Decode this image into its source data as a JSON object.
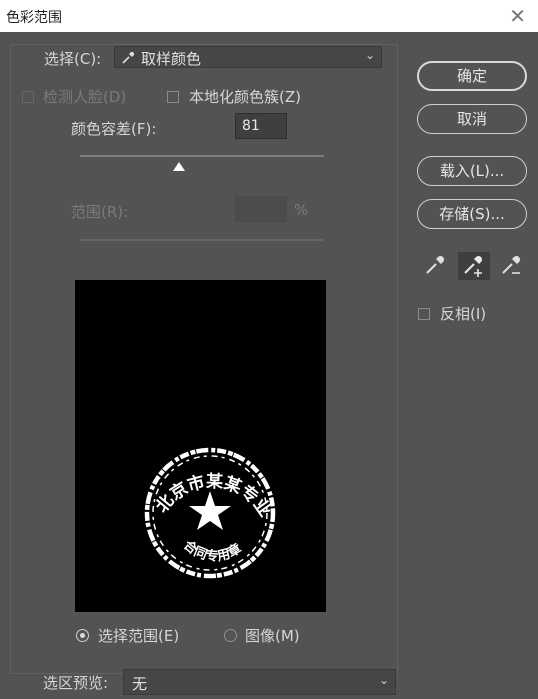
{
  "window": {
    "title": "色彩范围",
    "close_glyph": "✕"
  },
  "select": {
    "label": "选择(C):",
    "value": "取样颜色",
    "icon": "eyedropper-icon"
  },
  "detect_faces": {
    "label": "检测人脸(D)",
    "checked": false,
    "enabled": false
  },
  "localized": {
    "label": "本地化颜色簇(Z)",
    "checked": false
  },
  "fuzziness": {
    "label": "颜色容差(F):",
    "value": "81",
    "slider_fraction": 0.405
  },
  "range": {
    "label": "范围(R):",
    "value": "",
    "unit": "%",
    "enabled": false
  },
  "view_options": {
    "selection_label": "选择范围(E)",
    "image_label": "图像(M)",
    "selected": "selection"
  },
  "selection_preview": {
    "label": "选区预览:",
    "value": "无"
  },
  "buttons": {
    "ok": "确定",
    "cancel": "取消",
    "load": "载入(L)...",
    "save": "存储(S)..."
  },
  "droppers": {
    "sample": "eyedropper-icon",
    "add": "eyedropper-plus-icon",
    "subtract": "eyedropper-minus-icon",
    "active": "add"
  },
  "invert": {
    "label": "反相(I)",
    "checked": false
  },
  "colors": {
    "background": "#535353",
    "titlebar": "#ffffff",
    "text": "#d6d6d6",
    "disabled_text": "#7a7a7a",
    "preview_bg": "#000000",
    "stamp": "#ffffff"
  }
}
